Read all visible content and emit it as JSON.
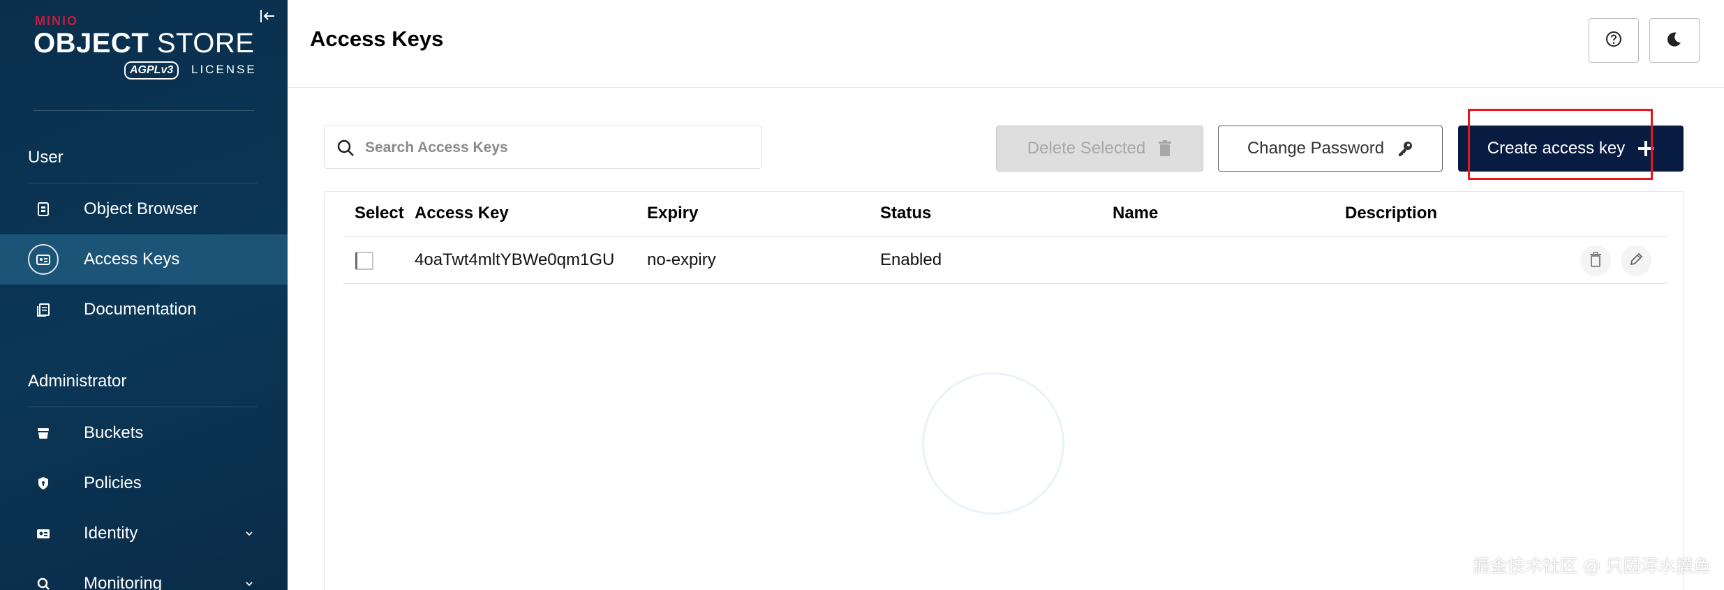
{
  "brand": {
    "minio": "MINIO",
    "product_bold": "OBJECT",
    "product_light": "STORE",
    "agpl": "AGPLv3",
    "license": "LICENSE"
  },
  "sidebar": {
    "user_section": "User",
    "user_items": [
      {
        "label": "Object Browser",
        "icon": "object-browser-icon"
      },
      {
        "label": "Access Keys",
        "icon": "access-keys-icon",
        "active": true
      },
      {
        "label": "Documentation",
        "icon": "documentation-icon"
      }
    ],
    "admin_section": "Administrator",
    "admin_items": [
      {
        "label": "Buckets",
        "icon": "bucket-icon"
      },
      {
        "label": "Policies",
        "icon": "policy-shield-icon"
      },
      {
        "label": "Identity",
        "icon": "identity-icon",
        "expandable": true
      },
      {
        "label": "Monitoring",
        "icon": "monitoring-icon",
        "expandable": true
      }
    ]
  },
  "header": {
    "title": "Access Keys",
    "help_icon": "help-circle-icon",
    "theme_icon": "moon-icon"
  },
  "toolbar": {
    "search_placeholder": "Search Access Keys",
    "delete_label": "Delete Selected",
    "change_password_label": "Change Password",
    "create_label": "Create access key"
  },
  "table": {
    "columns": [
      "Select",
      "Access Key",
      "Expiry",
      "Status",
      "Name",
      "Description"
    ],
    "rows": [
      {
        "access_key": "4oaTwt4mltYBWe0qm1GU",
        "expiry": "no-expiry",
        "status": "Enabled",
        "name": "",
        "description": ""
      }
    ]
  },
  "watermark": "掘金技术社区 @ 只因浑水摸鱼",
  "colors": {
    "sidebar_bg": "#0b3656",
    "active_item": "#1c5478",
    "primary_button": "#081c42",
    "highlight": "#e8151d",
    "brand_red": "#c51b3d"
  }
}
